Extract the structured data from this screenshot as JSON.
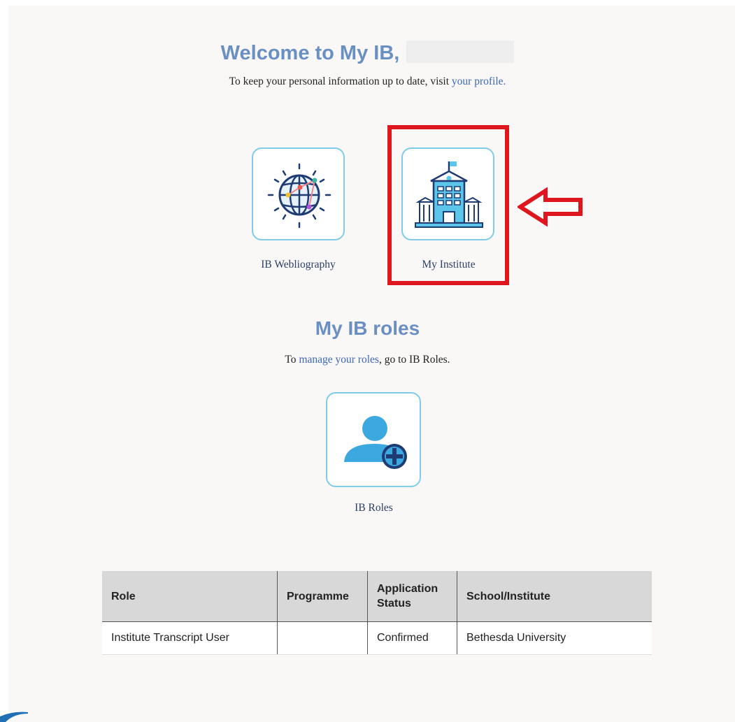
{
  "welcome": {
    "title": "Welcome to My IB,",
    "subtitle_prefix": "To keep your personal information up to date, visit",
    "profile_link": "your profile."
  },
  "tiles": [
    {
      "label": "IB Webliography",
      "icon": "globe-network-icon"
    },
    {
      "label": "My Institute",
      "icon": "school-building-icon"
    },
    {
      "label": "IB Roles",
      "icon": "add-user-icon"
    }
  ],
  "roles": {
    "title": "My IB roles",
    "sub_prefix": "To",
    "manage_link": "manage your roles",
    "sub_suffix": ", go to IB Roles."
  },
  "table": {
    "headers": [
      "Role",
      "Programme",
      "Application Status",
      "School/Institute"
    ],
    "rows": [
      [
        "Institute Transcript User",
        "",
        "Confirmed",
        "Bethesda University"
      ]
    ]
  },
  "colors": {
    "heading": "#6a8fc3",
    "link": "#3c68b8",
    "tile_border": "#7fcbe8",
    "highlight": "#e0161e"
  }
}
